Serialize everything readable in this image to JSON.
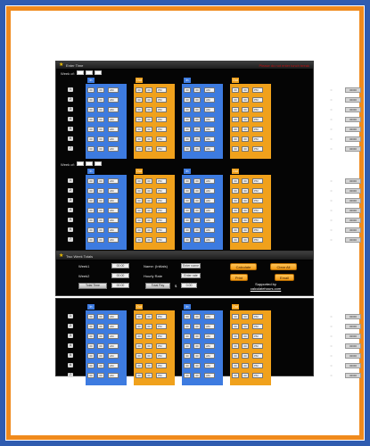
{
  "section1": {
    "title": "Enter Time",
    "warning": "Please do not enter lunch break",
    "week_label": "Week of:"
  },
  "section2": {
    "week_label": "Week of:"
  },
  "summary": {
    "title": "Two Week Totals",
    "week1_label": "Week1",
    "week1_value": "00:00",
    "week2_label": "Week2",
    "week2_value": "00:00",
    "total_time_label": "Total Time",
    "total_time_value": "00:00",
    "name_label": "Name: (Initials)",
    "name_placeholder": "Enter name",
    "hourly_rate_label": "Hourly Rate",
    "hourly_rate_placeholder": "Enter rate",
    "total_pay_label": "Total Pay",
    "currency": "$",
    "total_pay_value": "0.00",
    "calculate": "Calculate",
    "clear_all": "Clear All",
    "print": "Print",
    "email": "Email",
    "supported_by": "Supported by",
    "supported_link": "calculatehours.com"
  },
  "day_headers": {
    "in1": "In",
    "out1": "Out",
    "in2": "In",
    "out2": "Out"
  },
  "cell_hour": "00",
  "cell_min": "00",
  "am": "AM",
  "pm": "PM",
  "row_numbers": [
    "1",
    "2",
    "3",
    "4",
    "5",
    "6",
    "7"
  ],
  "result_label": "00:00",
  "colors": {
    "in": "#3d7be0",
    "out": "#f0a11c",
    "accent": "#f08a1c",
    "frame": "#2f5cb0"
  }
}
